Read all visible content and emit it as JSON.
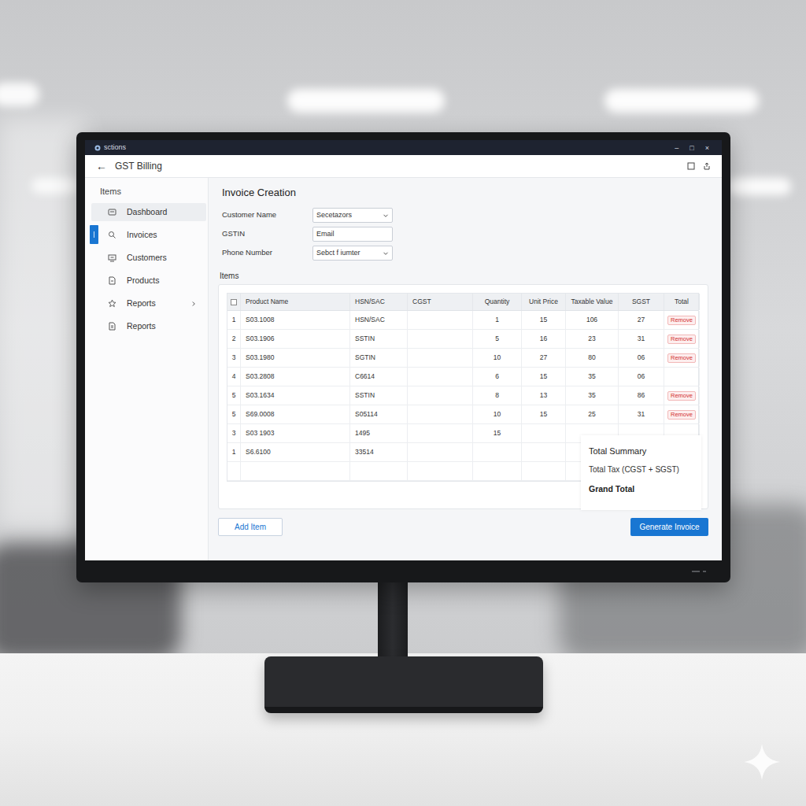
{
  "window": {
    "title": "sctions",
    "controls": [
      "–",
      "□",
      "×"
    ]
  },
  "app_bar": {
    "back": "←",
    "title": "GST Billing"
  },
  "sidebar": {
    "heading": "Items",
    "items": [
      {
        "label": "Dashboard",
        "selected": false,
        "hovered": true,
        "expandable": false
      },
      {
        "label": "Invoices",
        "selected": true,
        "hovered": false,
        "expandable": false
      },
      {
        "label": "Customers",
        "selected": false,
        "hovered": false,
        "expandable": false
      },
      {
        "label": "Products",
        "selected": false,
        "hovered": false,
        "expandable": false
      },
      {
        "label": "Reports",
        "selected": false,
        "hovered": false,
        "expandable": true
      },
      {
        "label": "Reports",
        "selected": false,
        "hovered": false,
        "expandable": false
      }
    ]
  },
  "form": {
    "title": "Invoice Creation",
    "fields": [
      {
        "label": "Customer Name",
        "kind": "select",
        "value": "Secetazors"
      },
      {
        "label": "GSTIN",
        "kind": "input",
        "value": "Email"
      },
      {
        "label": "Phone Number",
        "kind": "select",
        "value": "Sebct f iumter"
      }
    ]
  },
  "items_label": "Items",
  "table": {
    "select_all": {
      "checked": false
    },
    "columns": [
      "Product Name",
      "HSN/SAC",
      "CGST",
      "Quantity",
      "Unit Price",
      "Taxable Value",
      "SGST",
      "Total"
    ],
    "rows": [
      [
        "1",
        "S03.1008",
        "HSN/SAC",
        "",
        "1",
        "15",
        "106",
        "27",
        "Remove"
      ],
      [
        "2",
        "S03.1906",
        "SSTIN",
        "",
        "5",
        "16",
        "23",
        "31",
        "Remove"
      ],
      [
        "3",
        "S03.1980",
        "SGTIN",
        "",
        "10",
        "27",
        "80",
        "06",
        "Remove"
      ],
      [
        "4",
        "S03.2808",
        "C6614",
        "",
        "6",
        "15",
        "35",
        "06",
        ""
      ],
      [
        "5",
        "S03.1634",
        "SSTIN",
        "",
        "8",
        "13",
        "35",
        "86",
        "Remove"
      ],
      [
        "5",
        "S69.0008",
        "S05114",
        "",
        "10",
        "15",
        "25",
        "31",
        "Remove"
      ],
      [
        "3",
        "S03 1903",
        "1495",
        "",
        "15",
        "",
        "",
        "",
        ""
      ],
      [
        "1",
        "S6.6100",
        "33514",
        "",
        "",
        "",
        "",
        "",
        ""
      ],
      [
        "",
        "",
        "",
        "",
        "",
        "",
        "",
        "",
        ""
      ]
    ]
  },
  "summary": {
    "title": "Total Summary",
    "lines": [
      "Total Tax (CGST + SGST)",
      "Grand Total"
    ]
  },
  "buttons": {
    "add": "Add Item",
    "generate": "Generate Invoice"
  }
}
